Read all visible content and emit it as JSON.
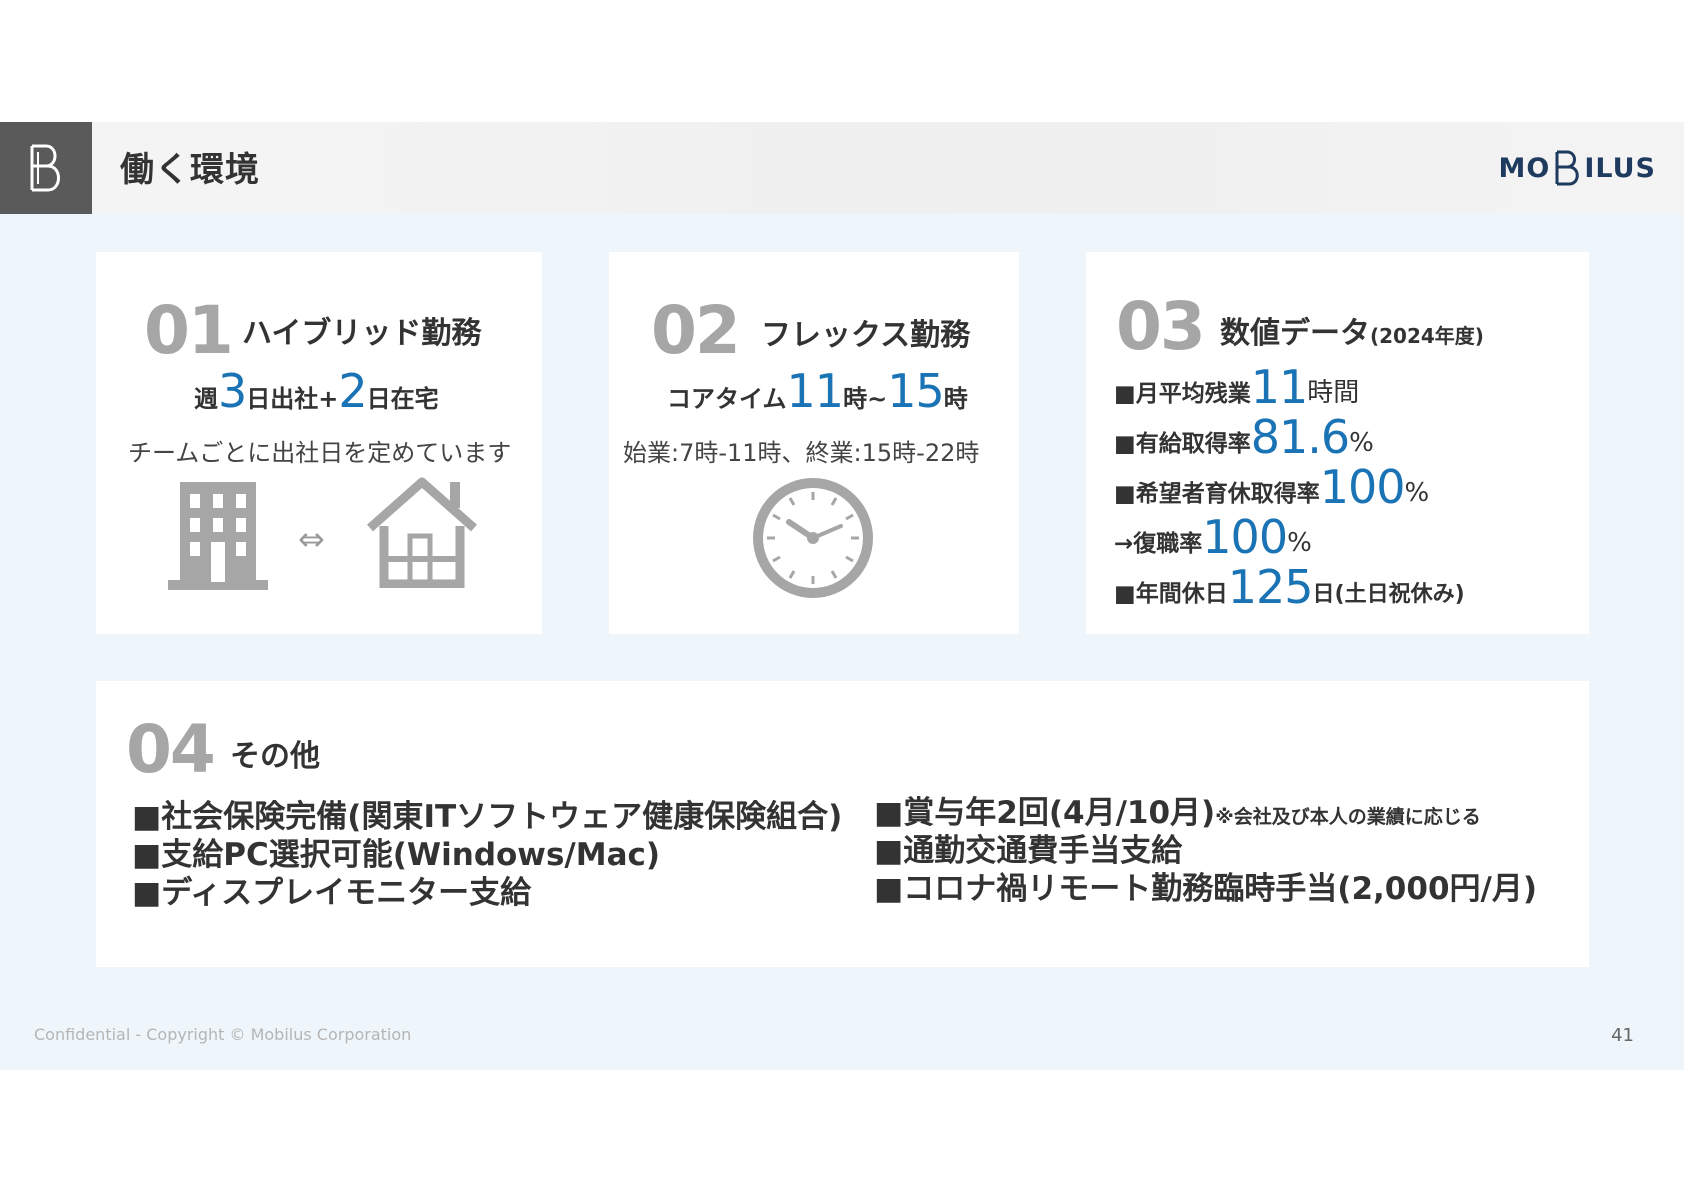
{
  "header": {
    "title": "働く環境",
    "brand": {
      "pre": "MO",
      "post": "ILUS"
    }
  },
  "card1": {
    "num": "01",
    "heading": "ハイブリッド勤務",
    "line1": {
      "a": "週",
      "b": "3",
      "c": "日出社+",
      "d": "2",
      "e": "日在宅"
    },
    "line2": "チームごとに出社日を定めています",
    "arrow": "⇔",
    "icons": [
      "office-building-icon",
      "house-icon"
    ]
  },
  "card2": {
    "num": "02",
    "heading": "フレックス勤務",
    "line1": {
      "a": "コアタイム",
      "b": "11",
      "c": "時~",
      "d": "15",
      "e": "時"
    },
    "line2": "始業:7時-11時、終業:15時-22時",
    "icon": "clock-icon"
  },
  "card3": {
    "num": "03",
    "heading": "数値データ",
    "heading_sub": "(2024年度)",
    "stats": [
      {
        "label": "■月平均残業",
        "value": "11",
        "unit": "時間"
      },
      {
        "label": "■有給取得率",
        "value": "81.6",
        "unit": "%"
      },
      {
        "label": "■希望者育休取得率",
        "value": "100",
        "unit": "%"
      },
      {
        "label": "→復職率",
        "value": "100",
        "unit": "%"
      },
      {
        "label": "■年間休日",
        "value": "125",
        "unit": "日(土日祝休み)"
      }
    ]
  },
  "card4": {
    "num": "04",
    "heading": "その他",
    "left_items": [
      "■社会保険完備(関東ITソフトウェア健康保険組合)",
      "■支給PC選択可能(Windows/Mac)",
      "■ディスプレイモニター支給"
    ],
    "right_items": [
      {
        "text": "■賞与年2回(4月/10月)",
        "note": "※会社及び本人の業績に応じる"
      },
      {
        "text": "■通勤交通費手当支給",
        "note": ""
      },
      {
        "text": "■コロナ禍リモート勤務臨時手当(2,000円/月)",
        "note": ""
      }
    ]
  },
  "footer": {
    "copyright": "Confidential - Copyright © Mobilus Corporation",
    "page": "41"
  }
}
